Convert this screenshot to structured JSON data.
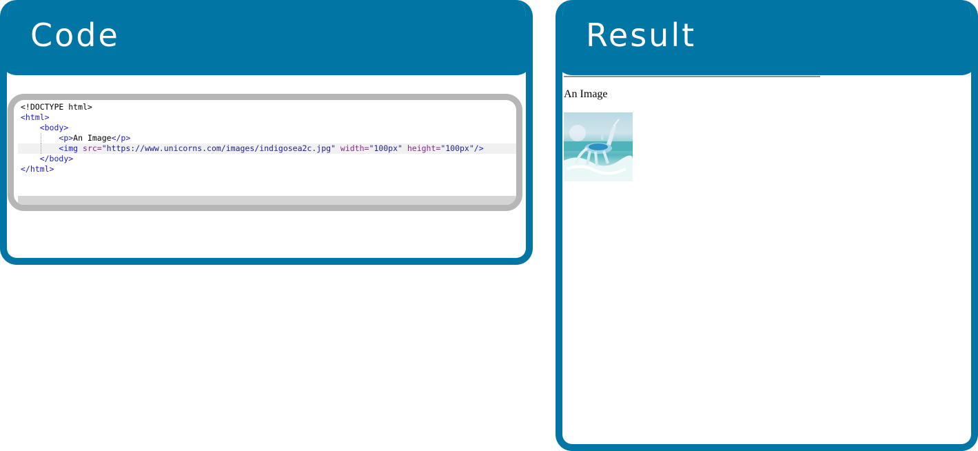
{
  "code_panel": {
    "title": "Code",
    "lines": [
      [
        {
          "t": "<!DOCTYPE html>",
          "c": "txt"
        }
      ],
      [
        {
          "t": "<html>",
          "c": "tag"
        }
      ],
      [
        {
          "t": "    "
        },
        {
          "t": "<body>",
          "c": "tag"
        }
      ],
      [
        {
          "t": "        "
        },
        {
          "t": "<p>",
          "c": "tag"
        },
        {
          "t": "An Image",
          "c": "txt"
        },
        {
          "t": "</p>",
          "c": "tag"
        }
      ],
      [
        {
          "t": "        "
        },
        {
          "t": "<img ",
          "c": "tag"
        },
        {
          "t": "src=",
          "c": "attr"
        },
        {
          "t": "\"https://www.unicorns.com/images/indigosea2c.jpg\"",
          "c": "str"
        },
        {
          "t": " width=",
          "c": "attr"
        },
        {
          "t": "\"100px\"",
          "c": "str"
        },
        {
          "t": " height=",
          "c": "attr"
        },
        {
          "t": "\"100px\"",
          "c": "str"
        },
        {
          "t": "/>",
          "c": "tag"
        }
      ],
      [
        {
          "t": "    "
        },
        {
          "t": "</body>",
          "c": "tag"
        }
      ],
      [
        {
          "t": "</html>",
          "c": "tag"
        }
      ]
    ],
    "active_line": 4
  },
  "result_panel": {
    "title": "Result",
    "paragraph": "An Image",
    "image_description_icon": "unicorn-image"
  },
  "colors": {
    "panel": "#0175a3",
    "editor_border": "#b6b6b6",
    "tag": "#1a1ad0",
    "attr": "#8a2a8f",
    "string": "#1f1f8f"
  }
}
